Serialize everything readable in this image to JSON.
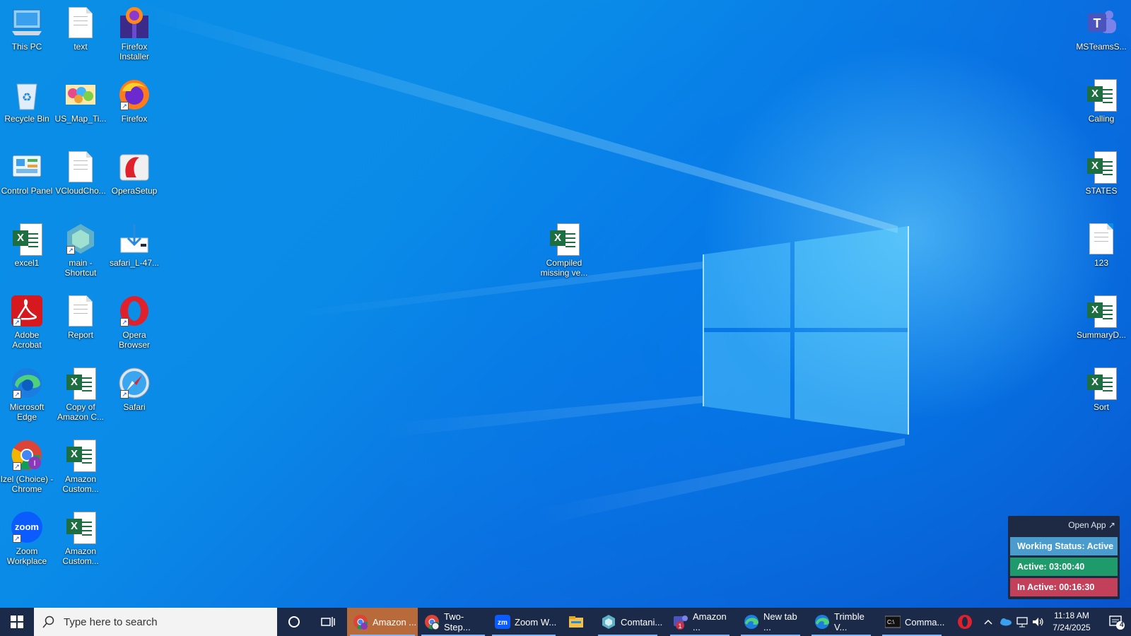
{
  "desktop": {
    "icons": [
      {
        "label": "This PC",
        "icon": "this-pc-icon"
      },
      {
        "label": "text",
        "icon": "text-document-icon"
      },
      {
        "label": "Firefox Installer",
        "icon": "firefox-installer-icon"
      },
      {
        "label": "Recycle Bin",
        "icon": "recycle-bin-icon"
      },
      {
        "label": "US_Map_Ti...",
        "icon": "image-file-icon"
      },
      {
        "label": "Firefox",
        "icon": "firefox-icon"
      },
      {
        "label": "Control Panel",
        "icon": "control-panel-icon"
      },
      {
        "label": "VCloudCho...",
        "icon": "text-document-icon"
      },
      {
        "label": "OperaSetup",
        "icon": "opera-setup-icon"
      },
      {
        "label": "excel1",
        "icon": "excel-file-icon"
      },
      {
        "label": "main - Shortcut",
        "icon": "app-shortcut-icon"
      },
      {
        "label": "safari_L-47...",
        "icon": "download-icon"
      },
      {
        "label": "Adobe Acrobat",
        "icon": "adobe-acrobat-icon"
      },
      {
        "label": "Report",
        "icon": "text-document-icon"
      },
      {
        "label": "Opera Browser",
        "icon": "opera-icon"
      },
      {
        "label": "Microsoft Edge",
        "icon": "edge-icon"
      },
      {
        "label": "Copy of Amazon C...",
        "icon": "excel-file-icon"
      },
      {
        "label": "Safari",
        "icon": "safari-icon"
      },
      {
        "label": "Izel (Choice) - Chrome",
        "icon": "chrome-icon"
      },
      {
        "label": "Amazon Custom...",
        "icon": "excel-file-icon"
      },
      {
        "label": "Zoom Workplace",
        "icon": "zoom-icon"
      },
      {
        "label": "Amazon Custom...",
        "icon": "excel-file-icon"
      },
      {
        "label": "Compiled missing ve...",
        "icon": "excel-file-icon"
      },
      {
        "label": "MSTeamsS...",
        "icon": "teams-icon"
      },
      {
        "label": "Calling",
        "icon": "excel-file-icon"
      },
      {
        "label": "STATES",
        "icon": "excel-file-icon"
      },
      {
        "label": "123",
        "icon": "text-document-icon"
      },
      {
        "label": "SummaryD...",
        "icon": "excel-file-icon"
      },
      {
        "label": "Sort",
        "icon": "excel-file-icon"
      }
    ]
  },
  "widget": {
    "open_app": "Open App ↗",
    "status": "Working Status: Active",
    "active": "Active: 03:00:40",
    "inactive": "In Active: 00:16:30",
    "colors": {
      "status": "#4a9ccf",
      "active": "#1f9a6a",
      "inactive": "#c2405a"
    }
  },
  "taskbar": {
    "search_placeholder": "Type here to search",
    "apps": [
      {
        "label": "Amazon ...",
        "icon": "chrome-icon"
      },
      {
        "label": "Two-Step...",
        "icon": "chrome-icon"
      },
      {
        "label": "Zoom W...",
        "icon": "zoom-icon"
      },
      {
        "label": "",
        "icon": "file-explorer-icon"
      },
      {
        "label": "Comtani...",
        "icon": "app-icon"
      },
      {
        "label": "Amazon ...",
        "icon": "teams-icon"
      },
      {
        "label": "New tab ...",
        "icon": "edge-icon"
      },
      {
        "label": "Trimble V...",
        "icon": "edge-icon"
      },
      {
        "label": "Comma...",
        "icon": "command-prompt-icon"
      },
      {
        "label": "",
        "icon": "opera-icon"
      }
    ],
    "teams_badge": "1",
    "clock_time": "11:18 AM",
    "clock_date": "7/24/2025",
    "notification_count": "4"
  }
}
